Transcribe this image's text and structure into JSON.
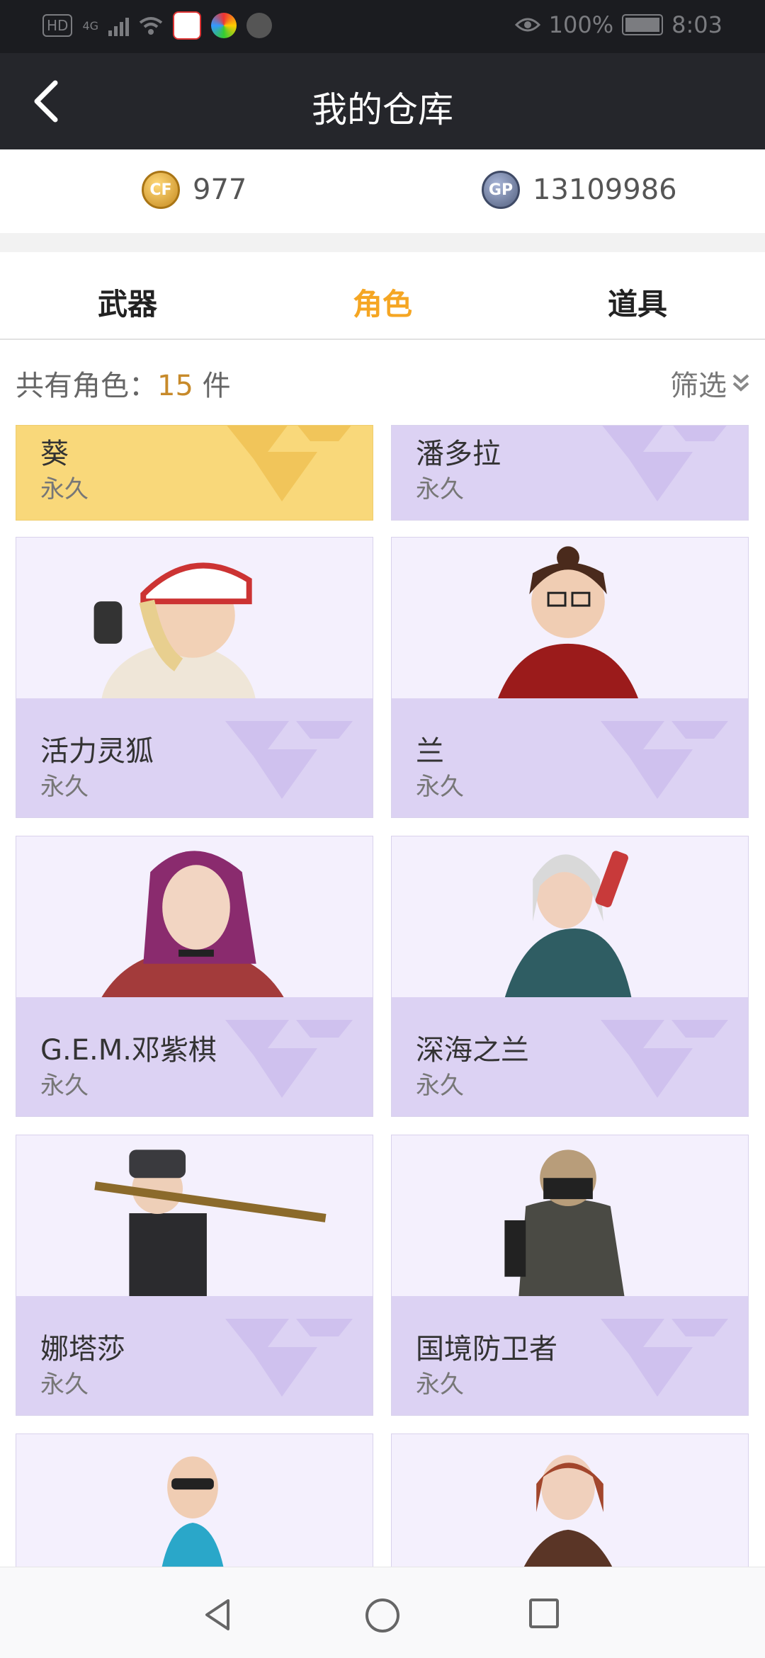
{
  "status_bar": {
    "network": "4G",
    "battery": "100%",
    "time": "8:03"
  },
  "header": {
    "title": "我的仓库"
  },
  "balances": {
    "cf_points": "977",
    "gp": "13109986"
  },
  "tabs": [
    {
      "label": "武器",
      "active": false
    },
    {
      "label": "角色",
      "active": true
    },
    {
      "label": "道具",
      "active": false
    }
  ],
  "summary": {
    "prefix": "共有角色：",
    "count": "15",
    "unit": " 件",
    "filter_label": "筛选"
  },
  "characters": [
    {
      "name": "葵",
      "duration": "永久"
    },
    {
      "name": "潘多拉",
      "duration": "永久"
    },
    {
      "name": "活力灵狐",
      "duration": "永久"
    },
    {
      "name": "兰",
      "duration": "永久"
    },
    {
      "name": "G.E.M.邓紫棋",
      "duration": "永久"
    },
    {
      "name": "深海之兰",
      "duration": "永久"
    },
    {
      "name": "娜塔莎",
      "duration": "永久"
    },
    {
      "name": "国境防卫者",
      "duration": "永久"
    }
  ],
  "colors": {
    "accent": "#f5a623",
    "card_purple": "#dcd2f3",
    "card_gold": "#f9d87a",
    "header_bg": "#25262b"
  },
  "icons": [
    "back-arrow-icon",
    "cf-coin-icon",
    "gp-coin-icon",
    "double-chevron-down-icon",
    "nav-back-icon",
    "nav-home-icon",
    "nav-recents-icon"
  ]
}
